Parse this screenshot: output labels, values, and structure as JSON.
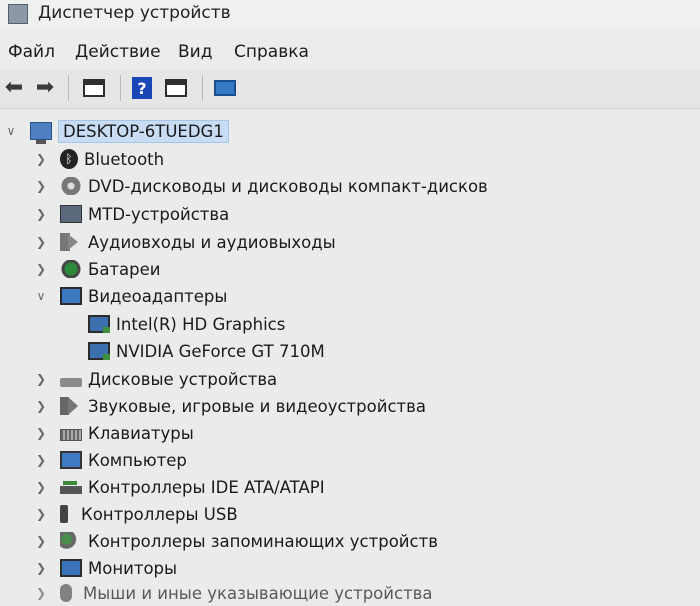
{
  "window": {
    "title": "Диспетчер устройств"
  },
  "menu": [
    "Файл",
    "Действие",
    "Вид",
    "Справка"
  ],
  "toolbar": {
    "help_glyph": "?"
  },
  "tree": {
    "root": "DESKTOP-6TUEDG1",
    "items": [
      {
        "label": "Bluetooth",
        "icon": "bluetooth-icon",
        "expanded": false
      },
      {
        "label": "DVD-дисководы и дисководы компакт-дисков",
        "icon": "dvd-drive-icon",
        "expanded": false
      },
      {
        "label": "MTD-устройства",
        "icon": "mtd-device-icon",
        "expanded": false
      },
      {
        "label": "Аудиовходы и аудиовыходы",
        "icon": "audio-io-icon",
        "expanded": false
      },
      {
        "label": "Батареи",
        "icon": "battery-icon",
        "expanded": false
      },
      {
        "label": "Видеоадаптеры",
        "icon": "display-adapter-icon",
        "expanded": true,
        "children": [
          "Intel(R) HD Graphics",
          "NVIDIA GeForce GT 710M"
        ]
      },
      {
        "label": "Дисковые устройства",
        "icon": "disk-drive-icon",
        "expanded": false
      },
      {
        "label": "Звуковые, игровые и видеоустройства",
        "icon": "sound-device-icon",
        "expanded": false
      },
      {
        "label": "Клавиатуры",
        "icon": "keyboard-icon",
        "expanded": false
      },
      {
        "label": "Компьютер",
        "icon": "computer-icon",
        "expanded": false
      },
      {
        "label": "Контроллеры IDE ATA/ATAPI",
        "icon": "ide-controller-icon",
        "expanded": false
      },
      {
        "label": "Контроллеры USB",
        "icon": "usb-controller-icon",
        "expanded": false
      },
      {
        "label": "Контроллеры запоминающих устройств",
        "icon": "storage-controller-icon",
        "expanded": false
      },
      {
        "label": "Мониторы",
        "icon": "monitor-icon",
        "expanded": false
      },
      {
        "label": "Мыши и иные указывающие устройства",
        "icon": "mouse-icon",
        "expanded": false
      }
    ]
  }
}
